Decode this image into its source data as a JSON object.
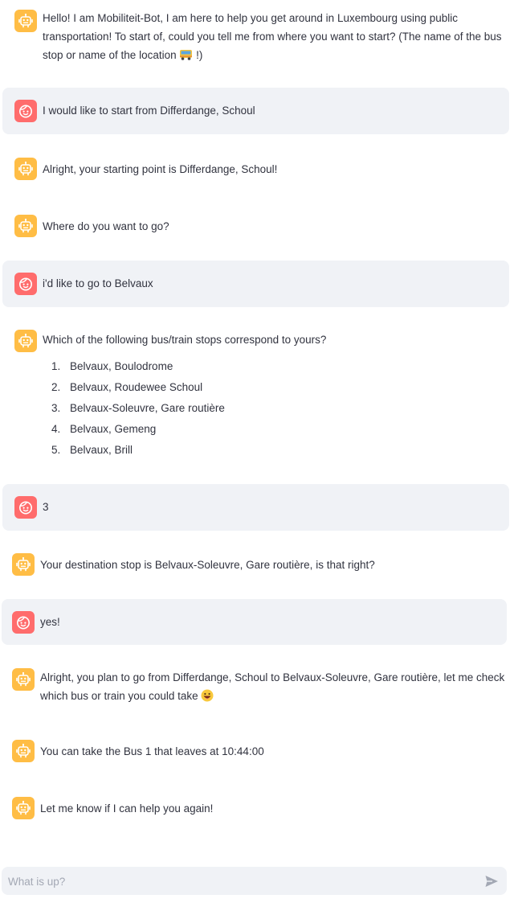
{
  "messages": [
    {
      "role": "bot",
      "text": "Hello! I am Mobiliteit-Bot, I am here to help you get around in Luxembourg using public transportation! To start of, could you tell me from where you want to start? (The name of the bus stop or name of the location",
      "text_after": "!)",
      "emoji": "bus-emoji"
    },
    {
      "role": "user",
      "text": "I would like to start from Differdange, Schoul"
    },
    {
      "role": "bot",
      "text": "Alright, your starting point is Differdange, Schoul!"
    },
    {
      "role": "bot",
      "text": "Where do you want to go?"
    },
    {
      "role": "user",
      "text": "i'd like to go to Belvaux"
    },
    {
      "role": "bot",
      "text": "Which of the following bus/train stops correspond to yours?",
      "options": [
        "Belvaux, Boulodrome",
        "Belvaux, Roudewee Schoul",
        "Belvaux-Soleuvre, Gare routière",
        "Belvaux, Gemeng",
        "Belvaux, Brill"
      ]
    },
    {
      "role": "user",
      "text": "3"
    },
    {
      "role": "bot",
      "text": "Your destination stop is Belvaux-Soleuvre, Gare routière, is that right?"
    },
    {
      "role": "user",
      "text": "yes!"
    },
    {
      "role": "bot",
      "text": "Alright, you plan to go from Differdange, Schoul to Belvaux-Soleuvre, Gare routière, let me check which bus or train you could take",
      "emoji": "grinning-face-emoji"
    },
    {
      "role": "bot",
      "text": "You can take the Bus 1 that leaves at 10:44:00"
    },
    {
      "role": "bot",
      "text": "Let me know if I can help you again!"
    }
  ],
  "chat_input": {
    "placeholder": "What is up?",
    "value": ""
  },
  "colors": {
    "bot_avatar": "#ffbd45",
    "user_avatar": "#ff6c6c",
    "user_bubble": "#f0f2f6",
    "text": "#31333f"
  }
}
